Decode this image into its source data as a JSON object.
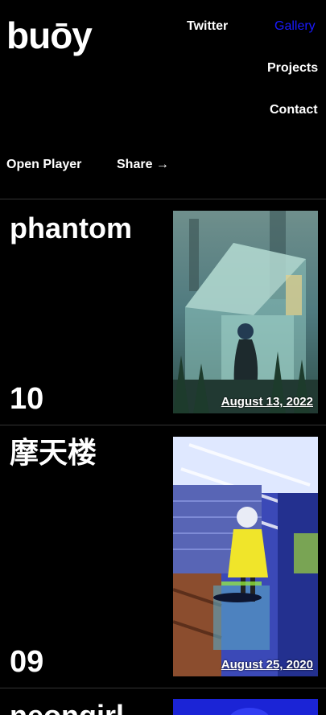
{
  "brand": {
    "logo": "buōy"
  },
  "nav": {
    "twitter": "Twitter",
    "gallery": "Gallery",
    "projects": "Projects",
    "contact": "Contact"
  },
  "actions": {
    "open_player": "Open Player",
    "share": "Share →"
  },
  "colors": {
    "background": "#000000",
    "text": "#ffffff",
    "active_nav": "#1a1aff",
    "divider": "#333333"
  },
  "cards": [
    {
      "title": "phantom",
      "number": "10",
      "date": "August 13, 2022"
    },
    {
      "title": "摩天楼",
      "number": "09",
      "date": "August 25, 2020"
    },
    {
      "title": "neongirl",
      "number": "",
      "date": ""
    }
  ]
}
